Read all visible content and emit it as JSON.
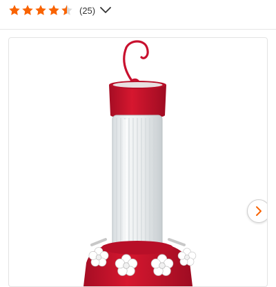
{
  "rating": {
    "value": 4.5,
    "max": 5,
    "count_label": "(25)",
    "star_color": "#f96302",
    "star_empty_color": "#d9d9d9"
  },
  "expand_icon": "chevron-down-icon",
  "gallery": {
    "next_icon": "chevron-right-icon",
    "accent_color": "#f96302",
    "product_image_alt": ""
  },
  "colors": {
    "feeder_red": "#c8102e",
    "divider": "#e6e6e6",
    "frame_border": "#e3e3e3"
  }
}
